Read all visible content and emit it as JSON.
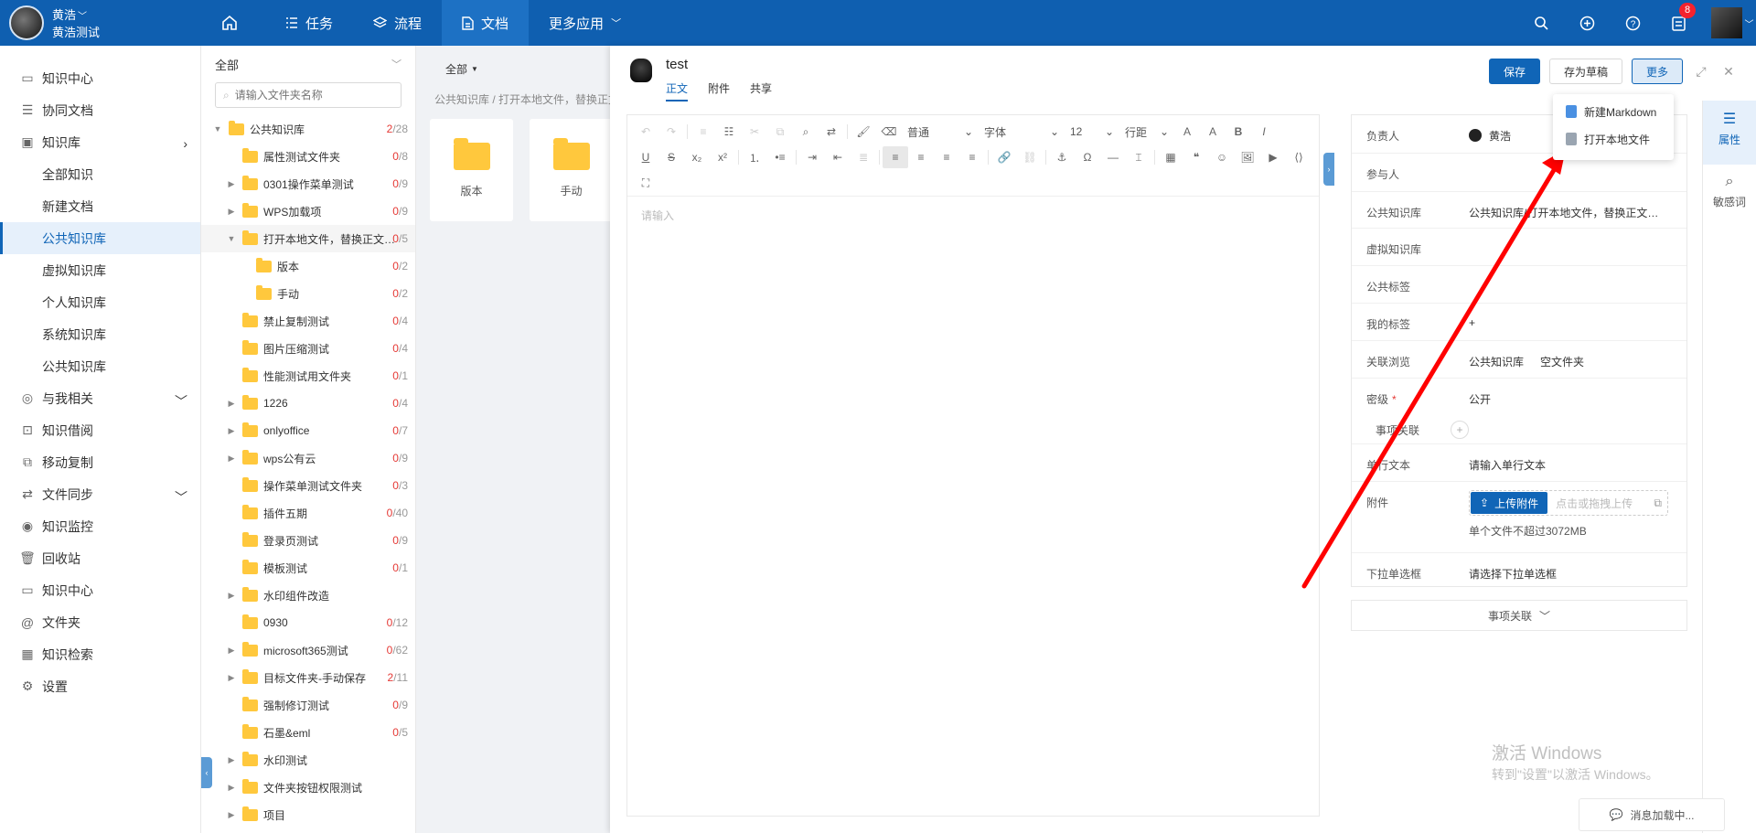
{
  "topbar": {
    "user_name": "黄浩",
    "user_sub": "黄浩测试",
    "nav": [
      {
        "label": ""
      },
      {
        "label": "任务"
      },
      {
        "label": "流程"
      },
      {
        "label": "文档"
      },
      {
        "label": "更多应用"
      }
    ],
    "badge_count": "8"
  },
  "sidebar": {
    "items": [
      {
        "label": "知识中心"
      },
      {
        "label": "协同文档"
      },
      {
        "label": "知识库"
      },
      {
        "label": "全部知识"
      },
      {
        "label": "新建文档"
      },
      {
        "label": "公共知识库"
      },
      {
        "label": "虚拟知识库"
      },
      {
        "label": "个人知识库"
      },
      {
        "label": "系统知识库"
      },
      {
        "label": "公共知识库"
      },
      {
        "label": "与我相关"
      },
      {
        "label": "知识借阅"
      },
      {
        "label": "移动复制"
      },
      {
        "label": "文件同步"
      },
      {
        "label": "知识监控"
      },
      {
        "label": "回收站"
      },
      {
        "label": "知识中心"
      },
      {
        "label": "文件夹"
      },
      {
        "label": "知识检索"
      },
      {
        "label": "设置"
      }
    ]
  },
  "tree": {
    "filter": "全部",
    "search_placeholder": "请输入文件夹名称",
    "rows": [
      {
        "name": "公共知识库",
        "red": "2",
        "total": "/28"
      },
      {
        "name": "属性测试文件夹",
        "red": "0",
        "total": "/8"
      },
      {
        "name": "0301操作菜单测试",
        "red": "0",
        "total": "/9"
      },
      {
        "name": "WPS加载项",
        "red": "0",
        "total": "/9"
      },
      {
        "name": "打开本地文件，替换正文…",
        "red": "0",
        "total": "/5"
      },
      {
        "name": "版本",
        "red": "0",
        "total": "/2"
      },
      {
        "name": "手动",
        "red": "0",
        "total": "/2"
      },
      {
        "name": "禁止复制测试",
        "red": "0",
        "total": "/4"
      },
      {
        "name": "图片压缩测试",
        "red": "0",
        "total": "/4"
      },
      {
        "name": "性能测试用文件夹",
        "red": "0",
        "total": "/1"
      },
      {
        "name": "1226",
        "red": "0",
        "total": "/4"
      },
      {
        "name": "onlyoffice",
        "red": "0",
        "total": "/7"
      },
      {
        "name": "wps公有云",
        "red": "0",
        "total": "/9"
      },
      {
        "name": "操作菜单测试文件夹",
        "red": "0",
        "total": "/3"
      },
      {
        "name": "插件五期",
        "red": "0",
        "total": "/40"
      },
      {
        "name": "登录页测试",
        "red": "0",
        "total": "/9"
      },
      {
        "name": "模板测试",
        "red": "0",
        "total": "/1"
      },
      {
        "name": "水印组件改造",
        "red": "",
        "total": ""
      },
      {
        "name": "0930",
        "red": "0",
        "total": "/12"
      },
      {
        "name": "microsoft365测试",
        "red": "0",
        "total": "/62"
      },
      {
        "name": "目标文件夹-手动保存",
        "red": "2",
        "total": "/11"
      },
      {
        "name": "强制修订测试",
        "red": "0",
        "total": "/9"
      },
      {
        "name": "石墨&eml",
        "red": "0",
        "total": "/5"
      },
      {
        "name": "水印测试",
        "red": "",
        "total": ""
      },
      {
        "name": "文件夹按钮权限测试",
        "red": "",
        "total": ""
      },
      {
        "name": "项目",
        "red": "",
        "total": ""
      }
    ]
  },
  "main": {
    "filter": "全部",
    "breadcrumb": "公共知识库 / 打开本地文件，替换正文",
    "cards": [
      {
        "label": "版本"
      },
      {
        "label": "手动"
      }
    ]
  },
  "editor": {
    "title": "test",
    "tabs": [
      {
        "label": "正文"
      },
      {
        "label": "附件"
      },
      {
        "label": "共享"
      }
    ],
    "save": "保存",
    "draft": "存为草稿",
    "more": "更多",
    "menu": [
      {
        "label": "新建Markdown"
      },
      {
        "label": "打开本地文件"
      }
    ],
    "toolbar": {
      "para": "普通",
      "font": "字体",
      "size": "12",
      "line": "行距"
    },
    "placeholder": "请输入"
  },
  "props": {
    "owner_label": "负责人",
    "owner_value": "黄浩",
    "participants_label": "参与人",
    "kb_label": "公共知识库",
    "kb_value": "公共知识库/打开本地文件，替换正文…",
    "vkb_label": "虚拟知识库",
    "ptag_label": "公共标签",
    "mytag_label": "我的标签",
    "mytag_value": "+",
    "rel_label": "关联浏览",
    "rel_value1": "公共知识库",
    "rel_value2": "空文件夹",
    "secret_label": "密级",
    "secret_value": "公开",
    "matter_label": "事项关联",
    "matter_add": "+",
    "text_label": "单行文本",
    "text_placeholder": "请输入单行文本",
    "attach_label": "附件",
    "upload_btn": "上传附件",
    "upload_hint": "点击或拖拽上传",
    "attach_limit": "单个文件不超过3072MB",
    "select_label": "下拉单选框",
    "select_placeholder": "请选择下拉单选框",
    "matters_collapse": "事项关联"
  },
  "rail": {
    "attr": "属性",
    "sensitive": "敏感词"
  },
  "watermark": {
    "line1": "激活 Windows",
    "line2": "转到\"设置\"以激活 Windows。"
  },
  "msg": {
    "label": "消息加载中..."
  }
}
